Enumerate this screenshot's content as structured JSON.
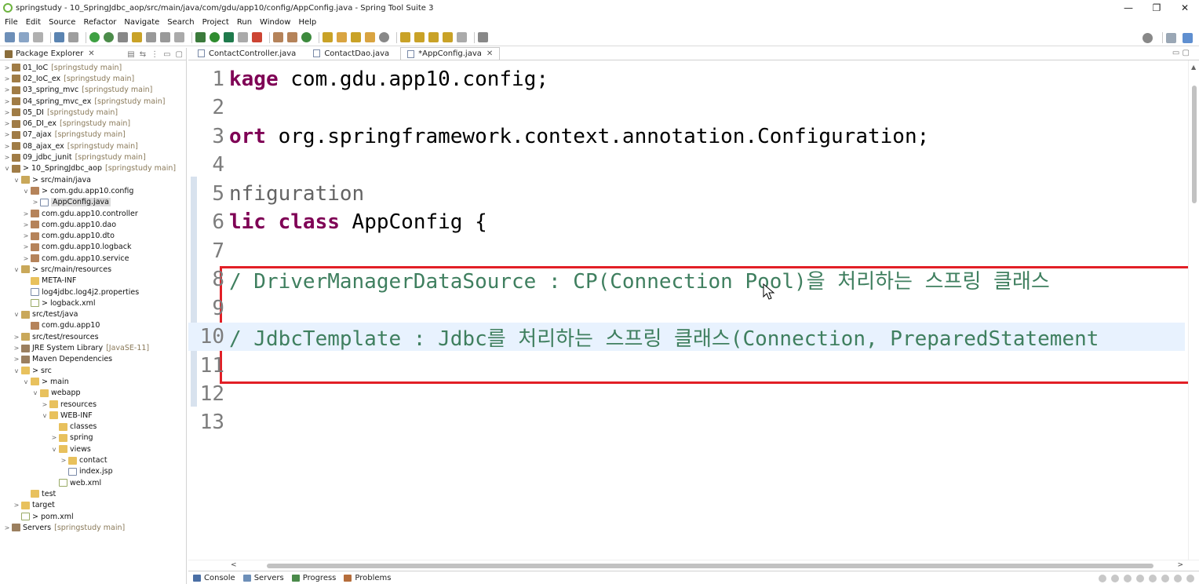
{
  "window": {
    "title": "springstudy - 10_SpringJdbc_aop/src/main/java/com/gdu/app10/config/AppConfig.java - Spring Tool Suite 3",
    "minimize": "—",
    "maximize": "❐",
    "close": "✕"
  },
  "menu": [
    "File",
    "Edit",
    "Source",
    "Refactor",
    "Navigate",
    "Search",
    "Project",
    "Run",
    "Window",
    "Help"
  ],
  "explorer": {
    "tab_label": "Package Explorer",
    "tree": [
      {
        "indent": 0,
        "twisty": ">",
        "icon": "project",
        "label": "01_IoC",
        "suffix": "[springstudy main]"
      },
      {
        "indent": 0,
        "twisty": ">",
        "icon": "project",
        "label": "02_IoC_ex",
        "suffix": "[springstudy main]"
      },
      {
        "indent": 0,
        "twisty": ">",
        "icon": "project",
        "label": "03_spring_mvc",
        "suffix": "[springstudy main]"
      },
      {
        "indent": 0,
        "twisty": ">",
        "icon": "project",
        "label": "04_spring_mvc_ex",
        "suffix": "[springstudy main]"
      },
      {
        "indent": 0,
        "twisty": ">",
        "icon": "project",
        "label": "05_DI",
        "suffix": "[springstudy main]"
      },
      {
        "indent": 0,
        "twisty": ">",
        "icon": "project",
        "label": "06_DI_ex",
        "suffix": "[springstudy main]"
      },
      {
        "indent": 0,
        "twisty": ">",
        "icon": "project",
        "label": "07_ajax",
        "suffix": "[springstudy main]"
      },
      {
        "indent": 0,
        "twisty": ">",
        "icon": "project",
        "label": "08_ajax_ex",
        "suffix": "[springstudy main]"
      },
      {
        "indent": 0,
        "twisty": ">",
        "icon": "project",
        "label": "09_jdbc_junit",
        "suffix": "[springstudy main]"
      },
      {
        "indent": 0,
        "twisty": "v",
        "icon": "project",
        "label": "> 10_SpringJdbc_aop",
        "suffix": "[springstudy main]"
      },
      {
        "indent": 1,
        "twisty": "v",
        "icon": "srcfolder",
        "label": "> src/main/java",
        "suffix": ""
      },
      {
        "indent": 2,
        "twisty": "v",
        "icon": "package",
        "label": "> com.gdu.app10.config",
        "suffix": ""
      },
      {
        "indent": 3,
        "twisty": ">",
        "icon": "file",
        "label": "AppConfig.java",
        "suffix": "",
        "selected": true
      },
      {
        "indent": 2,
        "twisty": ">",
        "icon": "package",
        "label": "com.gdu.app10.controller",
        "suffix": ""
      },
      {
        "indent": 2,
        "twisty": ">",
        "icon": "package",
        "label": "com.gdu.app10.dao",
        "suffix": ""
      },
      {
        "indent": 2,
        "twisty": ">",
        "icon": "package",
        "label": "com.gdu.app10.dto",
        "suffix": ""
      },
      {
        "indent": 2,
        "twisty": ">",
        "icon": "package",
        "label": "com.gdu.app10.logback",
        "suffix": ""
      },
      {
        "indent": 2,
        "twisty": ">",
        "icon": "package",
        "label": "com.gdu.app10.service",
        "suffix": ""
      },
      {
        "indent": 1,
        "twisty": "v",
        "icon": "srcfolder",
        "label": "> src/main/resources",
        "suffix": ""
      },
      {
        "indent": 2,
        "twisty": "",
        "icon": "folder",
        "label": "META-INF",
        "suffix": ""
      },
      {
        "indent": 2,
        "twisty": "",
        "icon": "file",
        "label": "log4jdbc.log4j2.properties",
        "suffix": ""
      },
      {
        "indent": 2,
        "twisty": "",
        "icon": "xml",
        "label": "> logback.xml",
        "suffix": ""
      },
      {
        "indent": 1,
        "twisty": "v",
        "icon": "srcfolder",
        "label": "src/test/java",
        "suffix": ""
      },
      {
        "indent": 2,
        "twisty": "",
        "icon": "package",
        "label": "com.gdu.app10",
        "suffix": ""
      },
      {
        "indent": 1,
        "twisty": ">",
        "icon": "srcfolder",
        "label": "src/test/resources",
        "suffix": ""
      },
      {
        "indent": 1,
        "twisty": ">",
        "icon": "lib",
        "label": "JRE System Library",
        "suffix": "[JavaSE-11]"
      },
      {
        "indent": 1,
        "twisty": ">",
        "icon": "lib",
        "label": "Maven Dependencies",
        "suffix": ""
      },
      {
        "indent": 1,
        "twisty": "v",
        "icon": "folder",
        "label": "> src",
        "suffix": ""
      },
      {
        "indent": 2,
        "twisty": "v",
        "icon": "folder",
        "label": "> main",
        "suffix": ""
      },
      {
        "indent": 3,
        "twisty": "v",
        "icon": "folder",
        "label": "webapp",
        "suffix": ""
      },
      {
        "indent": 4,
        "twisty": ">",
        "icon": "folder",
        "label": "resources",
        "suffix": ""
      },
      {
        "indent": 4,
        "twisty": "v",
        "icon": "folder",
        "label": "WEB-INF",
        "suffix": ""
      },
      {
        "indent": 5,
        "twisty": "",
        "icon": "folder",
        "label": "classes",
        "suffix": ""
      },
      {
        "indent": 5,
        "twisty": ">",
        "icon": "folder",
        "label": "spring",
        "suffix": ""
      },
      {
        "indent": 5,
        "twisty": "v",
        "icon": "folder",
        "label": "views",
        "suffix": ""
      },
      {
        "indent": 6,
        "twisty": ">",
        "icon": "folder",
        "label": "contact",
        "suffix": ""
      },
      {
        "indent": 6,
        "twisty": "",
        "icon": "file",
        "label": "index.jsp",
        "suffix": ""
      },
      {
        "indent": 5,
        "twisty": "",
        "icon": "xml",
        "label": "web.xml",
        "suffix": ""
      },
      {
        "indent": 2,
        "twisty": "",
        "icon": "folder",
        "label": "test",
        "suffix": ""
      },
      {
        "indent": 1,
        "twisty": ">",
        "icon": "folder",
        "label": "target",
        "suffix": ""
      },
      {
        "indent": 1,
        "twisty": "",
        "icon": "xml",
        "label": "> pom.xml",
        "suffix": ""
      },
      {
        "indent": 0,
        "twisty": ">",
        "icon": "lib",
        "label": "Servers",
        "suffix": "[springstudy main]"
      }
    ]
  },
  "editor": {
    "tabs": [
      {
        "label": "ContactController.java",
        "active": false
      },
      {
        "label": "ContactDao.java",
        "active": false
      },
      {
        "label": "*AppConfig.java",
        "active": true
      }
    ],
    "lines": [
      {
        "num": "1",
        "parts": [
          {
            "t": "kage",
            "c": "kw"
          },
          {
            "t": " com.gdu.app10.config;",
            "c": ""
          }
        ]
      },
      {
        "num": "2",
        "parts": []
      },
      {
        "num": "3",
        "parts": [
          {
            "t": "ort",
            "c": "kw"
          },
          {
            "t": " org.springframework.context.annotation.Configuration;",
            "c": ""
          }
        ]
      },
      {
        "num": "4",
        "parts": []
      },
      {
        "num": "5",
        "parts": [
          {
            "t": "nfiguration",
            "c": "anno"
          }
        ]
      },
      {
        "num": "6",
        "parts": [
          {
            "t": "lic",
            "c": "kw"
          },
          {
            "t": " ",
            "c": ""
          },
          {
            "t": "class",
            "c": "kw"
          },
          {
            "t": " AppConfig {",
            "c": ""
          }
        ]
      },
      {
        "num": "7",
        "parts": []
      },
      {
        "num": "8",
        "parts": [
          {
            "t": "/ DriverManagerDataSource : CP(Connection Pool)을 처리하는 스프링 클래스",
            "c": "cm"
          }
        ]
      },
      {
        "num": "9",
        "parts": []
      },
      {
        "num": "10",
        "parts": [
          {
            "t": "/ JdbcTemplate : Jdbc를 처리하는 스프링 클래스(Connection, PreparedStatement",
            "c": "cm"
          }
        ],
        "highlight": true
      },
      {
        "num": "11",
        "parts": []
      },
      {
        "num": "12",
        "parts": []
      },
      {
        "num": "13",
        "parts": []
      }
    ]
  },
  "bottom": {
    "tabs": [
      "Console",
      "Servers",
      "Progress",
      "Problems"
    ]
  },
  "colors": {
    "keyword": "#7f0055",
    "comment": "#3f7f5f",
    "annotation": "#646464",
    "highlight_box": "#e21f26",
    "current_line": "#e8f2fe"
  }
}
